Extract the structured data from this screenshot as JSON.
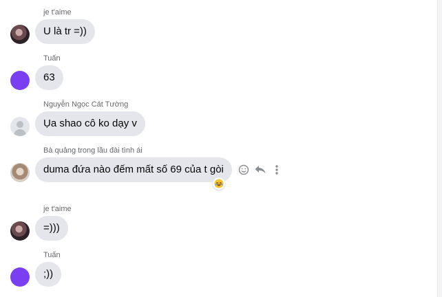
{
  "colors": {
    "bubble": "#e4e6eb",
    "sender": "#65676b",
    "text": "#050505",
    "purple_avatar": "#7b3ff2",
    "action_icon": "#8a8d91"
  },
  "messages": [
    {
      "sender": "je t'aime",
      "avatar": "photo",
      "text": "U là tr =))"
    },
    {
      "sender": "Tuấn",
      "avatar": "purple",
      "text": "63"
    },
    {
      "sender": "Nguyễn Ngọc Cát Tường",
      "avatar": "default-profile",
      "text": "Ụa shao cô ko dạy v"
    },
    {
      "sender": "Bà quảng trong lầu đài tình ái",
      "avatar": "photo",
      "text": "duma đứa nào đếm mất số 69 của t gòi",
      "reaction": "laughing-emoji",
      "hover_actions": [
        "react-smiley-icon",
        "reply-icon",
        "more-icon"
      ]
    },
    {
      "sender": "je t'aime",
      "avatar": "photo",
      "text": "=)))"
    },
    {
      "sender": "Tuấn",
      "avatar": "purple",
      "text": ";))"
    }
  ]
}
